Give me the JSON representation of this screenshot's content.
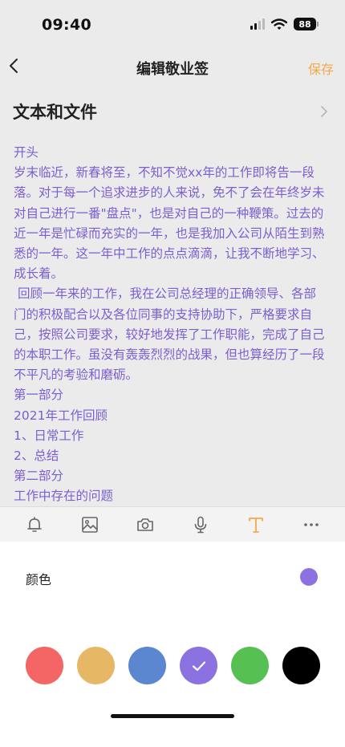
{
  "status_bar": {
    "time": "09:40",
    "battery": "88"
  },
  "nav": {
    "title": "编辑敬业签",
    "save_label": "保存"
  },
  "section": {
    "title": "文本和文件"
  },
  "content": {
    "lines": [
      "开头",
      "岁末临近，新春将至，不知不觉xx年的工作即将告一段落。对于每一个追求进步的人来说，免不了会在年终岁未对自己进行一番\"盘点\"，也是对自己的一种鞭策。过去的近一年是忙碌而充实的一年，也是我加入公司从陌生到熟悉的一年。这一年中工作的点点滴滴，让我不断地学习、成长着。",
      " 回顾一年来的工作，我在公司总经理的正确领导、各部门的积极配合以及各位同事的支持协助下，严格要求自己，按照公司要求，较好地发挥了工作职能，完成了自己的本职工作。虽没有轰轰烈烈的战果，但也算经历了一段不平凡的考验和磨砺。",
      "第一部分",
      "2021年工作回顾",
      "1、日常工作",
      "2、总结",
      "第二部分",
      "工作中存在的问题"
    ],
    "text_color": "#7b5fd0"
  },
  "toolbar": {
    "items": [
      {
        "icon": "bell-icon",
        "active": false
      },
      {
        "icon": "image-icon",
        "active": false
      },
      {
        "icon": "camera-icon",
        "active": false
      },
      {
        "icon": "microphone-icon",
        "active": false
      },
      {
        "icon": "text-format-icon",
        "active": true
      },
      {
        "icon": "more-icon",
        "active": false
      }
    ],
    "active_color": "#f5a84a"
  },
  "color_panel": {
    "label": "颜色",
    "selected_color": "#8c71e0",
    "swatches": [
      {
        "name": "red",
        "color": "#f46565",
        "selected": false
      },
      {
        "name": "orange",
        "color": "#e6b866",
        "selected": false
      },
      {
        "name": "blue",
        "color": "#5b87d0",
        "selected": false
      },
      {
        "name": "purple",
        "color": "#8c71e0",
        "selected": true
      },
      {
        "name": "green",
        "color": "#56c152",
        "selected": false
      },
      {
        "name": "black",
        "color": "#000000",
        "selected": false
      }
    ]
  }
}
